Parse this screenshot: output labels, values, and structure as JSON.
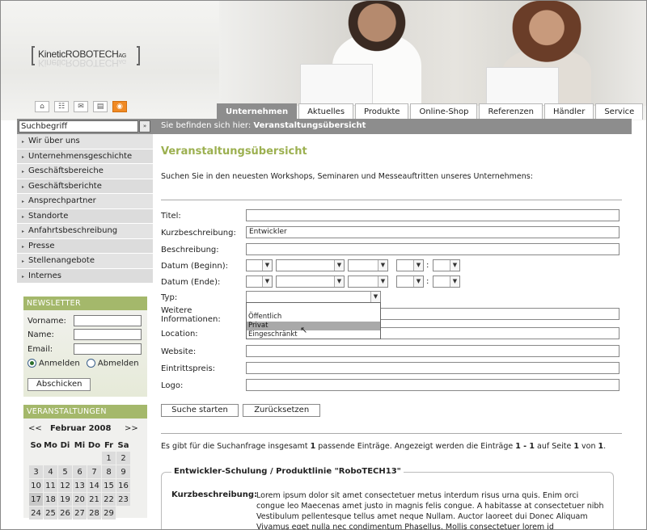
{
  "header": {
    "logo_text": "KineticROBOTECH",
    "logo_suffix": "AG",
    "icons": [
      "home-icon",
      "sitemap-icon",
      "mail-icon",
      "contact-card-icon",
      "rss-icon"
    ],
    "tabs": [
      {
        "label": "Unternehmen",
        "active": true
      },
      {
        "label": "Aktuelles"
      },
      {
        "label": "Produkte"
      },
      {
        "label": "Online-Shop"
      },
      {
        "label": "Referenzen"
      },
      {
        "label": "Händler"
      },
      {
        "label": "Service"
      }
    ]
  },
  "search": {
    "value": "Suchbegriff",
    "button": "»"
  },
  "breadcrumb": {
    "prefix": "Sie befinden sich hier:",
    "current": "Veranstaltungsübersicht"
  },
  "sidebar": {
    "items": [
      "Wir über uns",
      "Unternehmensgeschichte",
      "Geschäftsbereiche",
      "Geschäftsberichte",
      "Ansprechpartner",
      "Standorte",
      "Anfahrtsbeschreibung",
      "Presse",
      "Stellenangebote",
      "Internes"
    ]
  },
  "newsletter": {
    "title": "NEWSLETTER",
    "vorname": "Vorname:",
    "name": "Name:",
    "email": "Email:",
    "anmelden": "Anmelden",
    "abmelden": "Abmelden",
    "submit": "Abschicken"
  },
  "events_box": {
    "title": "VERANSTALTUNGEN",
    "prev": "<<",
    "month": "Februar 2008",
    "next": ">>",
    "weekdays": [
      "So",
      "Mo",
      "Di",
      "Mi",
      "Do",
      "Fr",
      "Sa"
    ],
    "weeks": [
      [
        "",
        "",
        "",
        "",
        "",
        "1",
        "2"
      ],
      [
        "3",
        "4",
        "5",
        "6",
        "7",
        "8",
        "9"
      ],
      [
        "10",
        "11",
        "12",
        "13",
        "14",
        "15",
        "16"
      ],
      [
        "17",
        "18",
        "19",
        "20",
        "21",
        "22",
        "23"
      ],
      [
        "24",
        "25",
        "26",
        "27",
        "28",
        "29",
        ""
      ]
    ],
    "today": "17"
  },
  "main": {
    "title": "Veranstaltungsübersicht",
    "intro": "Suchen Sie in den neuesten Workshops, Seminaren und Messeauftritten unseres Unternehmens:",
    "fields": {
      "titel": "Titel:",
      "kurz": "Kurzbeschreibung:",
      "kurz_value": "Entwickler",
      "beschreibung": "Beschreibung:",
      "datum_beginn": "Datum (Beginn):",
      "datum_ende": "Datum (Ende):",
      "typ": "Typ:",
      "weitere": "Weitere Informationen:",
      "location": "Location:",
      "website": "Website:",
      "eintritt": "Eintrittspreis:",
      "logo": "Logo:"
    },
    "typ_options": [
      "Öffentlich",
      "Privat",
      "Eingeschränkt"
    ],
    "typ_highlighted": "Privat",
    "search_button": "Suche starten",
    "reset_button": "Zurücksetzen",
    "result": {
      "t1": "Es gibt für die Suchanfrage insgesamt ",
      "count": "1",
      "t2": " passende Einträge. Angezeigt werden die Einträge ",
      "range": "1 - 1",
      "t3": " auf Seite ",
      "page": "1",
      "t4": " von ",
      "pages": "1",
      "t5": "."
    },
    "event": {
      "legend": "Entwickler-Schulung / Produktlinie \"RoboTECH13\"",
      "kurz_label": "Kurzbeschreibung:",
      "kurz_text": "Lorem ipsum dolor sit amet consectetuer metus interdum risus urna quis. Enim orci congue leo Maecenas amet justo in magnis felis congue. A habitasse at consectetuer nibh Vestibulum pellentesque tellus amet neque Nullam. Auctor laoreet dui Donec Aliquam Vivamus eget nulla nec condimentum Phasellus. Mollis consectetuer lorem id"
    }
  }
}
